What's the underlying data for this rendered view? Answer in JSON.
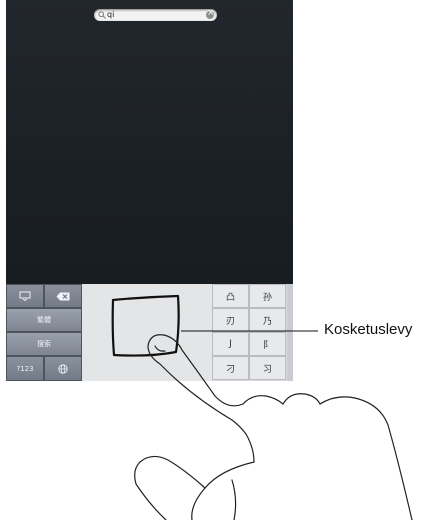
{
  "search": {
    "query": "qi"
  },
  "keyboard": {
    "key_next": "繁體",
    "key_search": "搜索",
    "key_123": "?123",
    "candidates": [
      "凸",
      "孙",
      "刃",
      "乃",
      "J",
      "阝",
      "刁",
      "习"
    ]
  },
  "callout": {
    "label": "Kosketuslevy"
  },
  "icons": {
    "hide_keyboard": "keyboard-hide-icon",
    "delete": "delete-icon",
    "globe": "globe-icon",
    "search": "search-icon",
    "clear": "clear-icon"
  }
}
